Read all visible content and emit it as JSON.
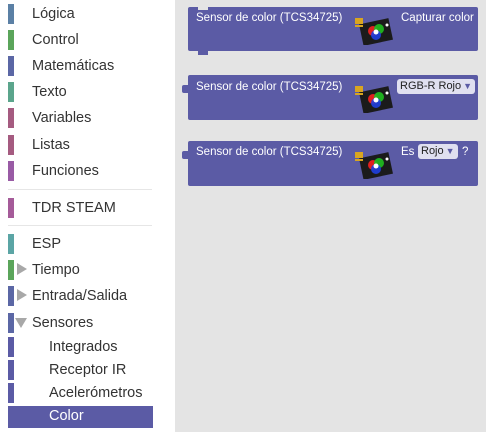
{
  "toolbox": {
    "categories": [
      {
        "label": "Lógica",
        "color": "#5b80a5"
      },
      {
        "label": "Control",
        "color": "#5ba55b"
      },
      {
        "label": "Matemáticas",
        "color": "#5b67a5"
      },
      {
        "label": "Texto",
        "color": "#5ba58c"
      },
      {
        "label": "Variables",
        "color": "#a55b80"
      },
      {
        "label": "Listas",
        "color": "#a55b80"
      },
      {
        "label": "Funciones",
        "color": "#995ba5"
      },
      {
        "label": "TDR STEAM",
        "color": "#a55b99"
      },
      {
        "label": "ESP",
        "color": "#5ba5a5"
      },
      {
        "label": "Tiempo",
        "color": "#5ba55b"
      },
      {
        "label": "Entrada/Salida",
        "color": "#5b67a5"
      },
      {
        "label": "Sensores",
        "color": "#5b67a5"
      },
      {
        "label": "Integrados",
        "color": "#5b5ba5"
      },
      {
        "label": "Receptor IR",
        "color": "#5b5ba5"
      },
      {
        "label": "Acelerómetros",
        "color": "#5b5ba5"
      },
      {
        "label": "Color",
        "color": "#5b5ba5"
      }
    ]
  },
  "blocks": {
    "capture": {
      "label": "Sensor de color (TCS34725)",
      "action": "Capturar color"
    },
    "rgb": {
      "label": "Sensor de color (TCS34725)",
      "dropdown": "RGB-R Rojo"
    },
    "is_color": {
      "label": "Sensor de color (TCS34725)",
      "prefix": "Es",
      "dropdown": "Rojo",
      "suffix": "?"
    }
  },
  "colors": {
    "block": "#5b5ba5",
    "workspace": "#e4e4e4",
    "selected": "#5b5ba5"
  }
}
